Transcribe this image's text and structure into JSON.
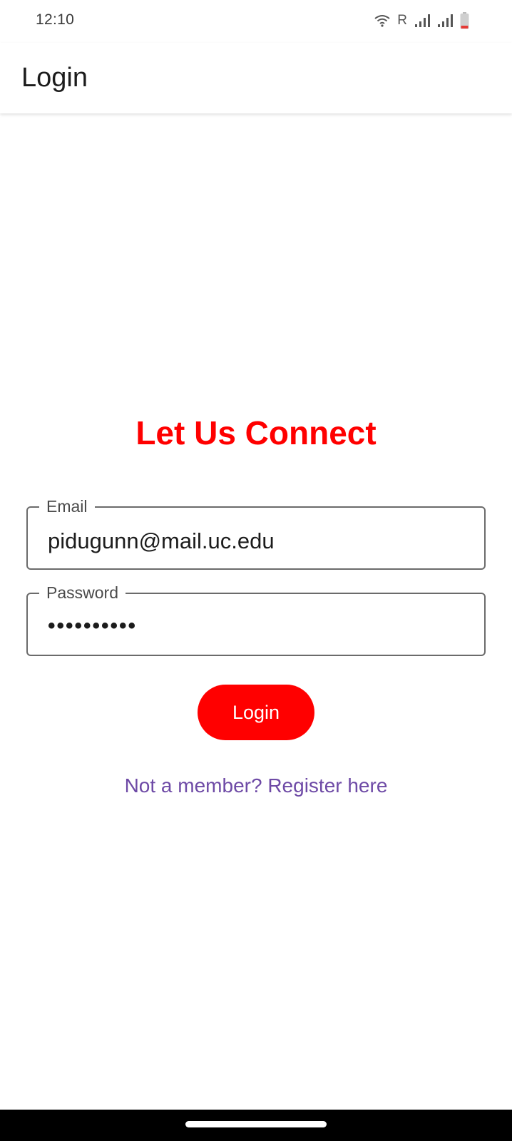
{
  "status_bar": {
    "time": "12:10",
    "roaming_indicator": "R",
    "icons": [
      "wifi-icon",
      "signal-icon",
      "signal-icon",
      "battery-low-icon"
    ],
    "battery_color": "#e53935"
  },
  "app_bar": {
    "title": "Login"
  },
  "main": {
    "headline": "Let Us Connect",
    "email": {
      "label": "Email",
      "value": "pidugunn@mail.uc.edu"
    },
    "password": {
      "label": "Password",
      "masked_value": "••••••••••"
    },
    "login_button_label": "Login",
    "register_link": "Not a member? Register here"
  },
  "colors": {
    "accent_red": "#ff0000",
    "link_purple": "#6e4aa6",
    "text_dark": "#1c1c1c",
    "outline_gray": "#6b6b6b"
  }
}
